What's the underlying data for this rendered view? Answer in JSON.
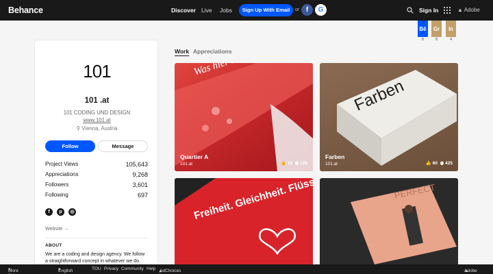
{
  "header": {
    "logo": "Behance",
    "nav": [
      "Discover",
      "Live",
      "Jobs"
    ],
    "signup": "Sign Up With Email",
    "or": "or",
    "signin": "Sign In",
    "adobe": "Adobe"
  },
  "ribbons": [
    {
      "label": "Bē",
      "count": "6"
    },
    {
      "label": "Gr",
      "count": "6"
    },
    {
      "label": "In",
      "count": "4"
    }
  ],
  "profile": {
    "avatar_text": "101",
    "name": "101 .at",
    "company": "101 CODING UND DESIGN",
    "link": "www.101.at",
    "location": "Vienna, Austria",
    "follow": "Follow",
    "message": "Message",
    "stats": [
      {
        "label": "Project Views",
        "value": "105,643"
      },
      {
        "label": "Appreciations",
        "value": "9,268"
      },
      {
        "label": "Followers",
        "value": "3,601"
      },
      {
        "label": "Following",
        "value": "697"
      }
    ],
    "website": "Website →",
    "about_heading": "ABOUT",
    "about_text": "We are a coding and design agency. We follow a straightforward concept in whatever we do. We"
  },
  "tabs": [
    "Work",
    "Appreciations"
  ],
  "projects": [
    {
      "title": "Quartier A",
      "owner": "101.at",
      "likes": "15",
      "views": "126",
      "art": "Was hier muss erst erfunden"
    },
    {
      "title": "Farben",
      "owner": "101.at",
      "likes": "60",
      "views": "425",
      "art": "Farben"
    },
    {
      "title": "",
      "owner": "",
      "likes": "",
      "views": "",
      "art": "Freiheit. Gleichheit. Flüssigkeit."
    },
    {
      "title": "",
      "owner": "",
      "likes": "",
      "views": "",
      "art": "PERFECT"
    }
  ],
  "footer": {
    "more": "More Behance",
    "lang": "English",
    "links": [
      "TOU",
      "Privacy",
      "Community",
      "Help",
      "AdChoices"
    ],
    "adobe": "Adobe"
  }
}
